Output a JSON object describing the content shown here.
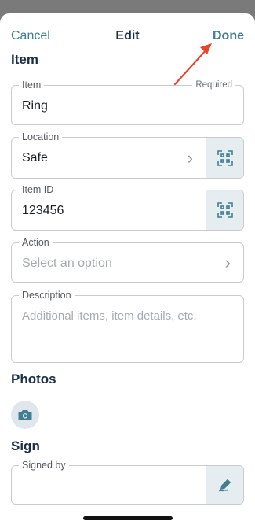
{
  "navbar": {
    "cancel_label": "Cancel",
    "title": "Edit",
    "done_label": "Done"
  },
  "item_section": {
    "title": "Item",
    "item_field": {
      "label": "Item",
      "required_label": "Required",
      "value": "Ring"
    },
    "location_field": {
      "label": "Location",
      "value": "Safe"
    },
    "item_id_field": {
      "label": "Item ID",
      "value": "123456"
    },
    "action_field": {
      "label": "Action",
      "placeholder": "Select an option"
    },
    "description_field": {
      "label": "Description",
      "placeholder": "Additional items, item details, etc."
    }
  },
  "photos_section": {
    "title": "Photos"
  },
  "sign_section": {
    "title": "Sign",
    "signed_by_field": {
      "label": "Signed by",
      "value": ""
    }
  },
  "colors": {
    "accent": "#3f7f8f",
    "heading": "#1c2f47",
    "annotation_arrow": "#e8452c",
    "icon_button_bg": "#e6edf1"
  },
  "icons": {
    "scan": "qr-scan-icon",
    "chevron": "chevron-right-icon",
    "camera": "camera-icon",
    "sign": "pen-sign-icon"
  }
}
